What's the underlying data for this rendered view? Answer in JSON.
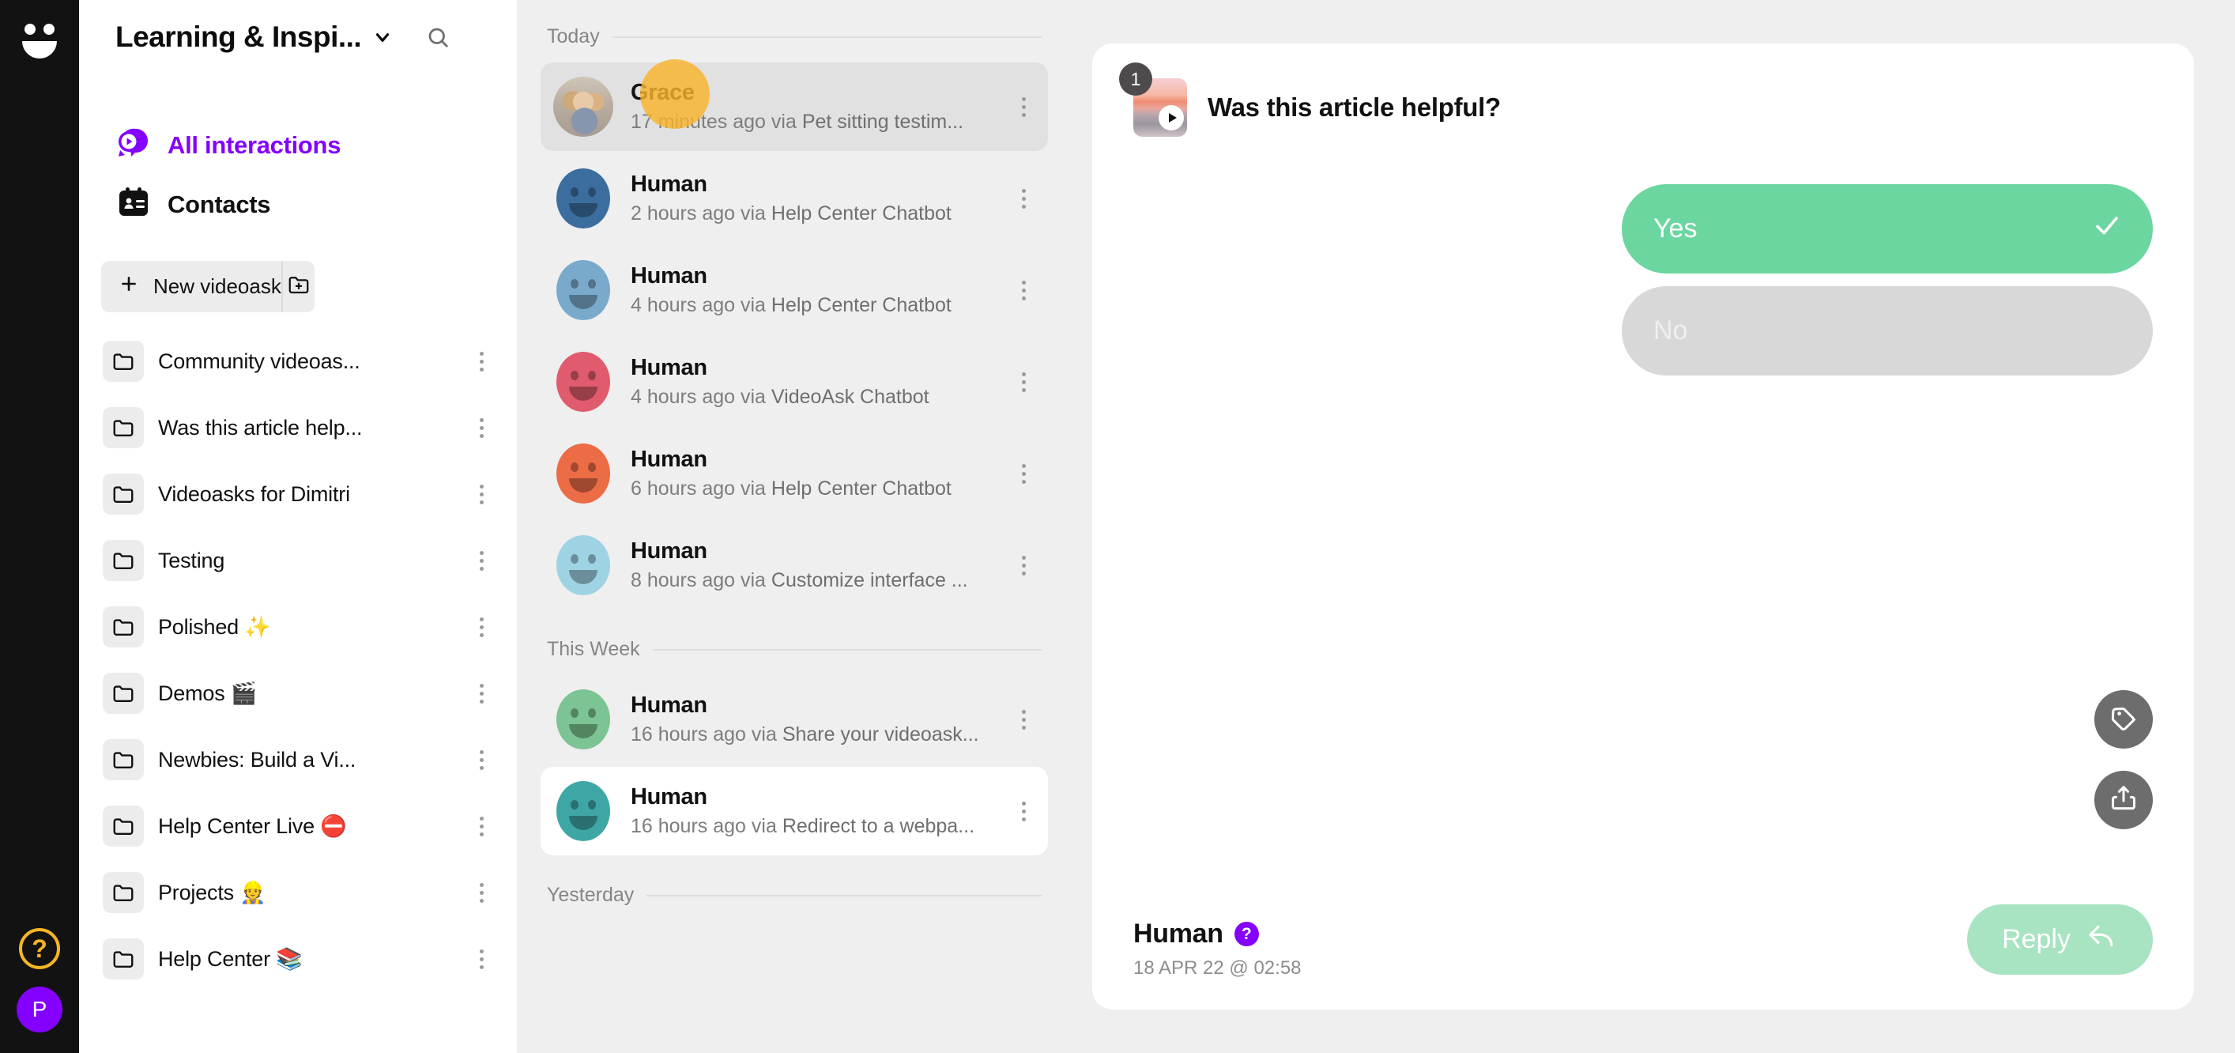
{
  "rail": {
    "logo_icon": "videoask-smiley-logo",
    "help_label": "?",
    "profile_initial": "P"
  },
  "sidebar": {
    "workspace_title": "Learning & Inspi...",
    "dropdown_icon": "chevron-down-icon",
    "search_icon": "search-icon",
    "nav": [
      {
        "label": "All interactions",
        "icon": "video-chat-bubble-icon",
        "active": true
      },
      {
        "label": "Contacts",
        "icon": "contacts-card-icon",
        "active": false
      }
    ],
    "new_videoask_label": "New videoask",
    "new_videoask_icon": "plus-icon",
    "new_folder_icon": "folder-plus-icon",
    "folders": [
      {
        "label": "Community videoas..."
      },
      {
        "label": "Was this article help..."
      },
      {
        "label": "Videoasks for Dimitri"
      },
      {
        "label": "Testing"
      },
      {
        "label": "Polished ✨"
      },
      {
        "label": "Demos 🎬"
      },
      {
        "label": "Newbies: Build a Vi..."
      },
      {
        "label": "Help Center Live ⛔"
      },
      {
        "label": "Projects 👷"
      },
      {
        "label": "Help Center 📚"
      }
    ]
  },
  "conversations": {
    "groups": [
      {
        "label": "Today",
        "items": [
          {
            "name": "Grace",
            "time": "17 minutes ago",
            "via": "via",
            "source": "Pet sitting testim...",
            "avatar": "photo-grace",
            "state": "selected"
          },
          {
            "name": "Human",
            "time": "2 hours ago",
            "via": "via",
            "source": "Help Center Chatbot",
            "avatar": "smiley",
            "color": "#3b6e9e",
            "state": ""
          },
          {
            "name": "Human",
            "time": "4 hours ago",
            "via": "via",
            "source": "Help Center Chatbot",
            "avatar": "smiley",
            "color": "#79aacb",
            "state": ""
          },
          {
            "name": "Human",
            "time": "4 hours ago",
            "via": "via",
            "source": "VideoAsk Chatbot",
            "avatar": "smiley",
            "color": "#e05b6e",
            "state": ""
          },
          {
            "name": "Human",
            "time": "6 hours ago",
            "via": "via",
            "source": "Help Center Chatbot",
            "avatar": "smiley",
            "color": "#ec6c46",
            "state": ""
          },
          {
            "name": "Human",
            "time": "8 hours ago",
            "via": "via",
            "source": "Customize interface ...",
            "avatar": "smiley",
            "color": "#9ed3e3",
            "state": ""
          }
        ]
      },
      {
        "label": "This Week",
        "items": [
          {
            "name": "Human",
            "time": "16 hours ago",
            "via": "via",
            "source": "Share your videoask...",
            "avatar": "smiley",
            "color": "#7cc493",
            "state": ""
          },
          {
            "name": "Human",
            "time": "16 hours ago",
            "via": "via",
            "source": "Redirect to a webpa...",
            "avatar": "smiley",
            "color": "#3fa6a6",
            "state": "hovered"
          }
        ]
      },
      {
        "label": "Yesterday",
        "items": []
      }
    ]
  },
  "main": {
    "step_badge": "1",
    "thumbnail_icon": "video-thumbnail-sunset",
    "play_icon": "play-icon",
    "question": "Was this article helpful?",
    "answers": [
      {
        "label": "Yes",
        "selected": true,
        "check_icon": "check-icon",
        "color": "#6bd6a0"
      },
      {
        "label": "No",
        "selected": false,
        "color": "#d8d8d8"
      }
    ],
    "actions": [
      {
        "icon": "tag-icon",
        "name": "tag-button"
      },
      {
        "icon": "share-icon",
        "name": "share-button"
      }
    ],
    "respondent_name": "Human",
    "respondent_help_icon": "question-mark-badge",
    "timestamp": "18 APR 22 @ 02:58",
    "reply_label": "Reply",
    "reply_icon": "reply-arrow-icon"
  },
  "colors": {
    "brand_purple": "#8400ff",
    "accent_yellow": "#f5b525",
    "green": "#6bd6a0",
    "reply_green": "#a8e3c2",
    "rail_black": "#121212",
    "bg_grey": "#efefef"
  }
}
